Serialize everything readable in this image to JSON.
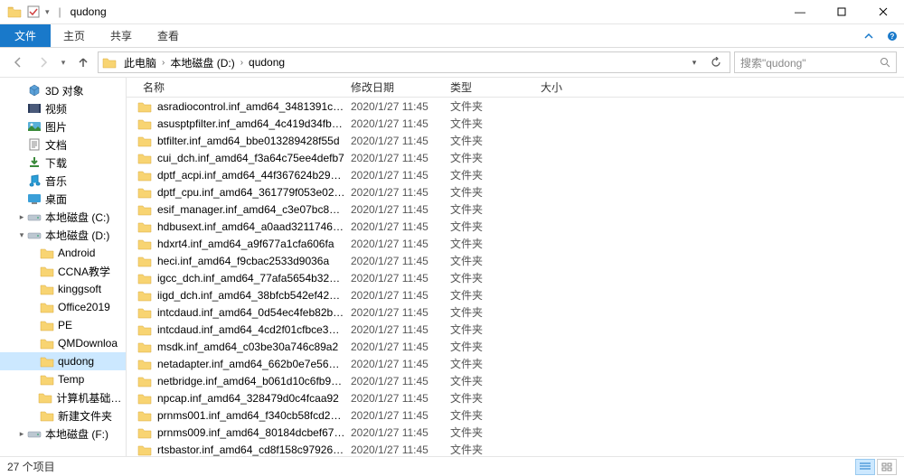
{
  "window": {
    "title": "qudong",
    "minimize": "—",
    "maximize": "☐",
    "close": "✕"
  },
  "ribbon": {
    "file": "文件",
    "tabs": [
      "主页",
      "共享",
      "查看"
    ]
  },
  "breadcrumbs": [
    "此电脑",
    "本地磁盘 (D:)",
    "qudong"
  ],
  "search": {
    "placeholder": "搜索\"qudong\""
  },
  "columns": {
    "name": "名称",
    "date": "修改日期",
    "type": "类型",
    "size": "大小"
  },
  "sidebar": [
    {
      "label": "3D 对象",
      "indent": 1,
      "icon": "3d"
    },
    {
      "label": "视频",
      "indent": 1,
      "icon": "video"
    },
    {
      "label": "图片",
      "indent": 1,
      "icon": "pic"
    },
    {
      "label": "文档",
      "indent": 1,
      "icon": "doc"
    },
    {
      "label": "下载",
      "indent": 1,
      "icon": "dl"
    },
    {
      "label": "音乐",
      "indent": 1,
      "icon": "music"
    },
    {
      "label": "桌面",
      "indent": 1,
      "icon": "desktop"
    },
    {
      "label": "本地磁盘 (C:)",
      "indent": 1,
      "icon": "drive",
      "exp": "▸"
    },
    {
      "label": "本地磁盘 (D:)",
      "indent": 1,
      "icon": "drive",
      "exp": "▾"
    },
    {
      "label": "Android",
      "indent": 2,
      "icon": "folder"
    },
    {
      "label": "CCNA教学",
      "indent": 2,
      "icon": "folder"
    },
    {
      "label": "kinggsoft",
      "indent": 2,
      "icon": "folder"
    },
    {
      "label": "Office2019",
      "indent": 2,
      "icon": "folder"
    },
    {
      "label": "PE",
      "indent": 2,
      "icon": "folder"
    },
    {
      "label": "QMDownloa",
      "indent": 2,
      "icon": "folder"
    },
    {
      "label": "qudong",
      "indent": 2,
      "icon": "folder",
      "selected": true
    },
    {
      "label": "Temp",
      "indent": 2,
      "icon": "folder"
    },
    {
      "label": "计算机基础与应",
      "indent": 2,
      "icon": "folder"
    },
    {
      "label": "新建文件夹",
      "indent": 2,
      "icon": "folder"
    },
    {
      "label": "本地磁盘 (F:)",
      "indent": 1,
      "icon": "drive",
      "exp": "▸"
    }
  ],
  "files": [
    {
      "name": "asradiocontrol.inf_amd64_3481391c8...",
      "date": "2020/1/27 11:45",
      "type": "文件夹"
    },
    {
      "name": "asusptpfilter.inf_amd64_4c419d34fb9...",
      "date": "2020/1/27 11:45",
      "type": "文件夹"
    },
    {
      "name": "btfilter.inf_amd64_bbe013289428f55d",
      "date": "2020/1/27 11:45",
      "type": "文件夹"
    },
    {
      "name": "cui_dch.inf_amd64_f3a64c75ee4defb7",
      "date": "2020/1/27 11:45",
      "type": "文件夹"
    },
    {
      "name": "dptf_acpi.inf_amd64_44f367624b292f...",
      "date": "2020/1/27 11:45",
      "type": "文件夹"
    },
    {
      "name": "dptf_cpu.inf_amd64_361779f053e025ac",
      "date": "2020/1/27 11:45",
      "type": "文件夹"
    },
    {
      "name": "esif_manager.inf_amd64_c3e07bc8cd...",
      "date": "2020/1/27 11:45",
      "type": "文件夹"
    },
    {
      "name": "hdbusext.inf_amd64_a0aad32117464...",
      "date": "2020/1/27 11:45",
      "type": "文件夹"
    },
    {
      "name": "hdxrt4.inf_amd64_a9f677a1cfa606fa",
      "date": "2020/1/27 11:45",
      "type": "文件夹"
    },
    {
      "name": "heci.inf_amd64_f9cbac2533d9036a",
      "date": "2020/1/27 11:45",
      "type": "文件夹"
    },
    {
      "name": "igcc_dch.inf_amd64_77afa5654b325675",
      "date": "2020/1/27 11:45",
      "type": "文件夹"
    },
    {
      "name": "iigd_dch.inf_amd64_38bfcb542ef4272e",
      "date": "2020/1/27 11:45",
      "type": "文件夹"
    },
    {
      "name": "intcdaud.inf_amd64_0d54ec4feb82b9...",
      "date": "2020/1/27 11:45",
      "type": "文件夹"
    },
    {
      "name": "intcdaud.inf_amd64_4cd2f01cfbce3160",
      "date": "2020/1/27 11:45",
      "type": "文件夹"
    },
    {
      "name": "msdk.inf_amd64_c03be30a746c89a2",
      "date": "2020/1/27 11:45",
      "type": "文件夹"
    },
    {
      "name": "netadapter.inf_amd64_662b0e7e568b...",
      "date": "2020/1/27 11:45",
      "type": "文件夹"
    },
    {
      "name": "netbridge.inf_amd64_b061d10c6fb98...",
      "date": "2020/1/27 11:45",
      "type": "文件夹"
    },
    {
      "name": "npcap.inf_amd64_328479d0c4fcaa92",
      "date": "2020/1/27 11:45",
      "type": "文件夹"
    },
    {
      "name": "prnms001.inf_amd64_f340cb58fcd232...",
      "date": "2020/1/27 11:45",
      "type": "文件夹"
    },
    {
      "name": "prnms009.inf_amd64_80184dcbef677...",
      "date": "2020/1/27 11:45",
      "type": "文件夹"
    },
    {
      "name": "rtsbastor.inf_amd64_cd8f158c979261...",
      "date": "2020/1/27 11:45",
      "type": "文件夹"
    }
  ],
  "status": {
    "count": "27 个项目"
  }
}
